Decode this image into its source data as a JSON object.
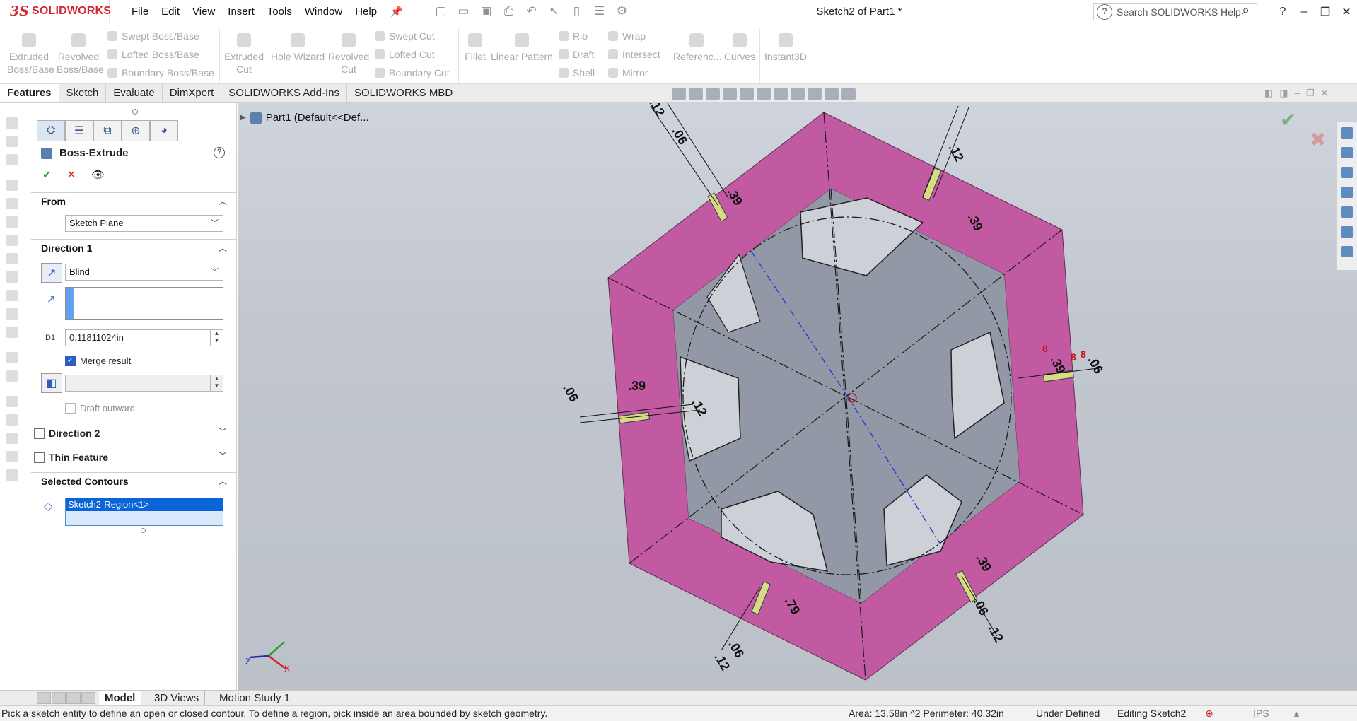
{
  "app": {
    "logo_ds": "3S",
    "logo_text": "SOLIDWORKS",
    "document_title": "Sketch2 of Part1 *"
  },
  "menus": [
    "File",
    "Edit",
    "View",
    "Insert",
    "Tools",
    "Window",
    "Help"
  ],
  "search": {
    "placeholder": "Search SOLIDWORKS Help"
  },
  "ribbon": {
    "extruded_boss": "Extruded\nBoss/Base",
    "revolved_boss": "Revolved\nBoss/Base",
    "swept_boss": "Swept Boss/Base",
    "lofted_boss": "Lofted Boss/Base",
    "boundary_boss": "Boundary Boss/Base",
    "extruded_cut": "Extruded\nCut",
    "hole_wizard": "Hole Wizard",
    "revolved_cut": "Revolved\nCut",
    "swept_cut": "Swept Cut",
    "lofted_cut": "Lofted Cut",
    "boundary_cut": "Boundary Cut",
    "fillet": "Fillet",
    "linear_pattern": "Linear Pattern",
    "rib": "Rib",
    "draft": "Draft",
    "shell": "Shell",
    "wrap": "Wrap",
    "intersect": "Intersect",
    "mirror": "Mirror",
    "reference": "Referenc...",
    "curves": "Curves",
    "instant3d": "Instant3D"
  },
  "tabs": [
    "Features",
    "Sketch",
    "Evaluate",
    "DimXpert",
    "SOLIDWORKS Add-Ins",
    "SOLIDWORKS MBD"
  ],
  "pm": {
    "title": "Boss-Extrude",
    "from_header": "From",
    "from_value": "Sketch Plane",
    "dir1_header": "Direction 1",
    "end_condition": "Blind",
    "depth": "0.11811024in",
    "merge_result": "Merge result",
    "draft_outward": "Draft outward",
    "direction2": "Direction 2",
    "thin_feature": "Thin Feature",
    "selected_contours": "Selected Contours",
    "contour_item": "Sketch2-Region<1>"
  },
  "tree": {
    "part": "Part1  (Default<<Def..."
  },
  "dims": {
    "d39": ".39",
    "d06": ".06",
    "d12": ".12",
    "d79": ".79"
  },
  "bottom_tabs": [
    "Model",
    "3D Views",
    "Motion Study 1"
  ],
  "status": {
    "hint": "Pick a sketch entity to define an open or closed contour. To define a region, pick inside an area bounded by sketch geometry.",
    "area": "Area: 13.58in ^2 Perimeter: 40.32in",
    "state": "Under Defined",
    "editing": "Editing Sketch2",
    "units": "IPS"
  },
  "colors": {
    "ring": "#c25aa2",
    "face": "#9298a6",
    "background": "#c6cbd3",
    "accent": "#d4262e"
  }
}
